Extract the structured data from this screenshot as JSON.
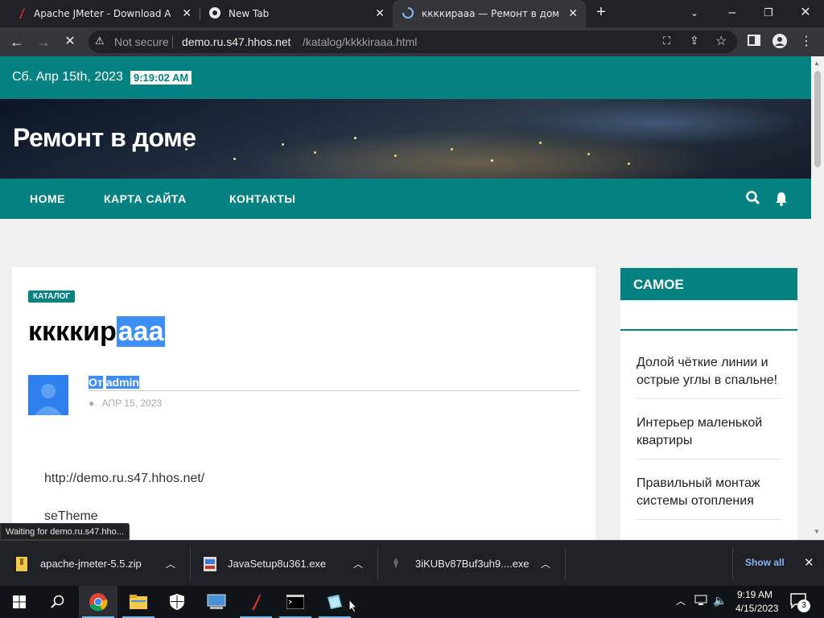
{
  "browser": {
    "tabs": [
      {
        "title": "Apache JMeter - Download Apac",
        "icon": "jmeter-feather-icon"
      },
      {
        "title": "New Tab",
        "icon": "chrome-icon"
      },
      {
        "title": "ккккираaa — Ремонт в доме",
        "icon": "loading-spinner-icon",
        "active": true
      }
    ],
    "security_label": "Not secure",
    "url_host": "demo.ru.s47.hhos.net",
    "url_path": "/katalog/kkkkiraaa.html",
    "status_text": "Waiting for demo.ru.s47.hho..."
  },
  "site": {
    "date": "Сб. Апр 15th, 2023",
    "time": "9:19:02 AM",
    "title": "Ремонт в доме",
    "nav": [
      "HOME",
      "КАРТА САЙТА",
      "КОНТАКТЫ"
    ],
    "accent_color": "#048181"
  },
  "post": {
    "category": "КАТАЛОГ",
    "title_plain": "ккккир",
    "title_selected": "aaa",
    "author_prefix": "От",
    "author": "admin",
    "date": "АПР 15, 2023",
    "body_line1": "http://demo.ru.s47.hhos.net/",
    "body_line2": "seTheme"
  },
  "sidebar": {
    "heading": "САМОЕ",
    "items": [
      "Долой чёткие линии и острые углы в спальне!",
      "Интерьер маленькой квартиры",
      "Правильный монтаж системы отопления"
    ]
  },
  "downloads": {
    "items": [
      "apache-jmeter-5.5.zip",
      "JavaSetup8u361.exe",
      "3iKUBv87Buf3uh9....exe"
    ],
    "show_all": "Show all"
  },
  "taskbar": {
    "time": "9:19 AM",
    "date": "4/15/2023",
    "notification_count": "3"
  }
}
